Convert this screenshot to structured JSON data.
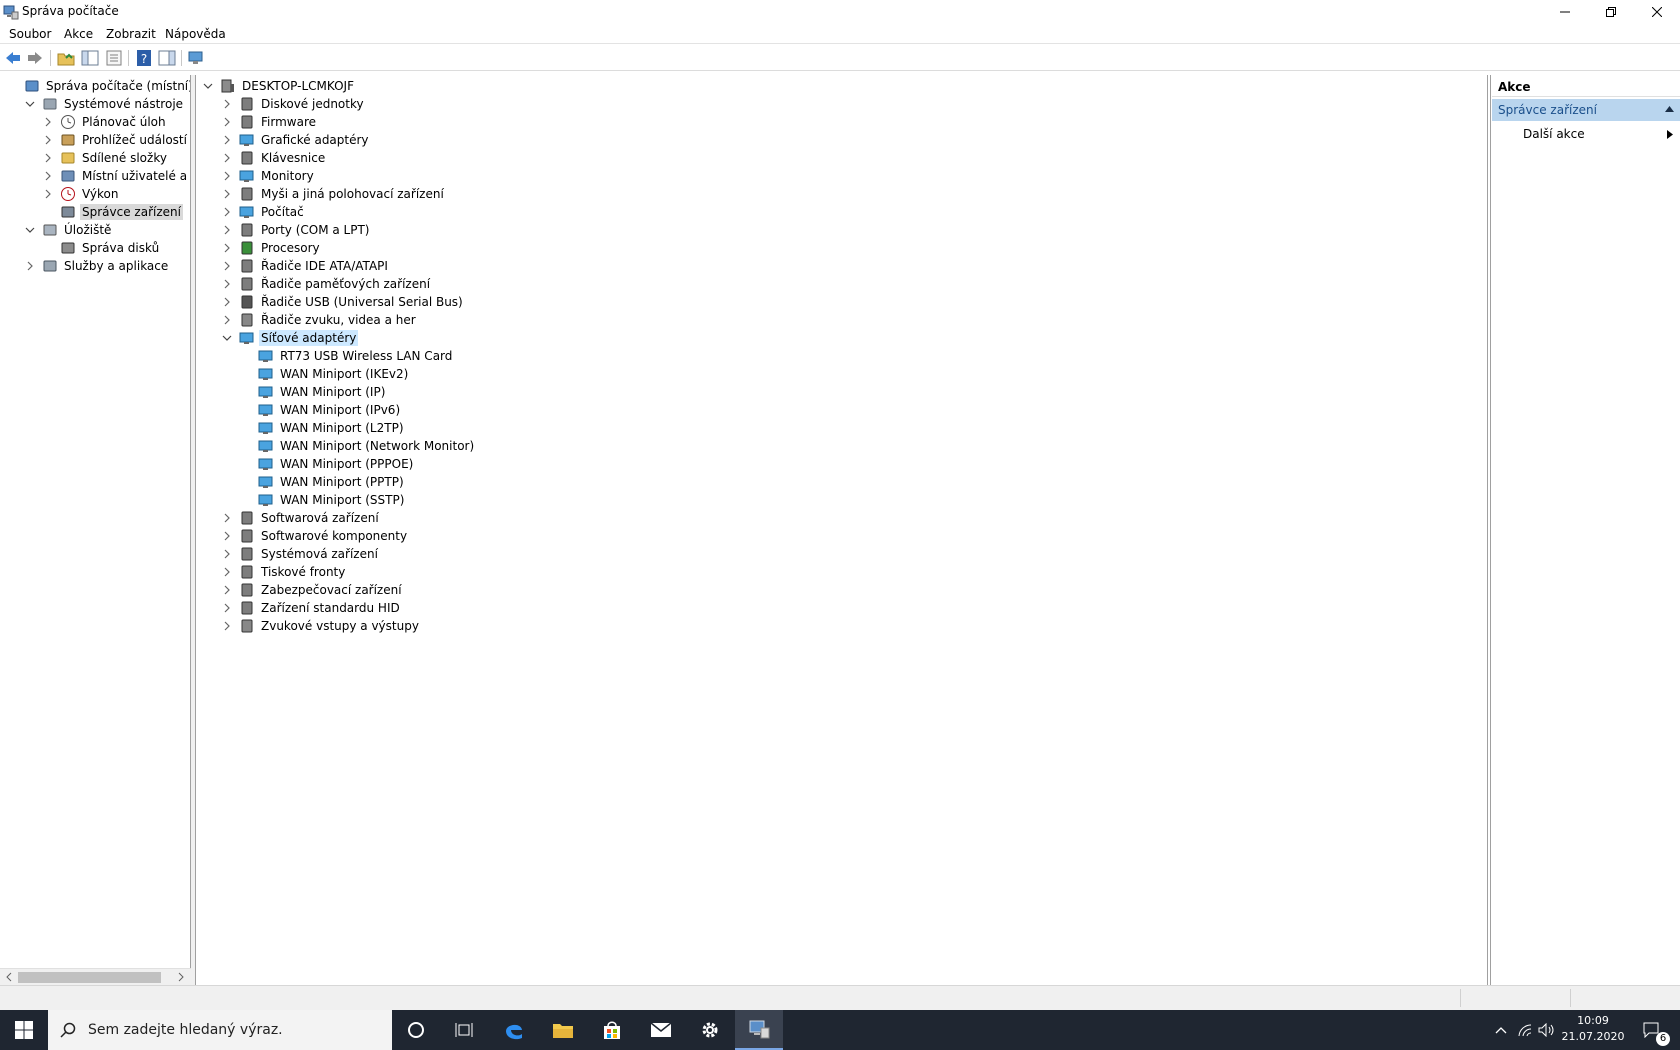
{
  "window": {
    "title": "Správa počítače"
  },
  "menu": [
    "Soubor",
    "Akce",
    "Zobrazit",
    "Nápověda"
  ],
  "left_tree": [
    {
      "label": "Správa počítače (místní)",
      "icon": "computer-management-icon",
      "level": 0,
      "expander": "none"
    },
    {
      "label": "Systémové nástroje",
      "icon": "tools-icon",
      "level": 1,
      "expander": "expanded"
    },
    {
      "label": "Plánovač úloh",
      "icon": "clock-icon",
      "level": 2,
      "expander": "collapsed"
    },
    {
      "label": "Prohlížeč událostí",
      "icon": "event-viewer-icon",
      "level": 2,
      "expander": "collapsed"
    },
    {
      "label": "Sdílené složky",
      "icon": "shared-folder-icon",
      "level": 2,
      "expander": "collapsed"
    },
    {
      "label": "Místní uživatelé a skupiny",
      "icon": "users-icon",
      "level": 2,
      "expander": "collapsed"
    },
    {
      "label": "Výkon",
      "icon": "performance-icon",
      "level": 2,
      "expander": "collapsed"
    },
    {
      "label": "Správce zařízení",
      "icon": "device-manager-icon",
      "level": 2,
      "expander": "none",
      "selected": true
    },
    {
      "label": "Úložiště",
      "icon": "storage-icon",
      "level": 1,
      "expander": "expanded"
    },
    {
      "label": "Správa disků",
      "icon": "disk-icon",
      "level": 2,
      "expander": "none"
    },
    {
      "label": "Služby a aplikace",
      "icon": "services-icon",
      "level": 1,
      "expander": "collapsed"
    }
  ],
  "device_tree": {
    "root": "DESKTOP-LCMKOJF",
    "categories": [
      {
        "label": "Diskové jednotky",
        "icon": "disk-drive-icon"
      },
      {
        "label": "Firmware",
        "icon": "firmware-icon"
      },
      {
        "label": "Grafické adaptéry",
        "icon": "display-adapter-icon"
      },
      {
        "label": "Klávesnice",
        "icon": "keyboard-icon"
      },
      {
        "label": "Monitory",
        "icon": "monitor-icon"
      },
      {
        "label": "Myši a jiná polohovací zařízení",
        "icon": "mouse-icon"
      },
      {
        "label": "Počítač",
        "icon": "computer-icon"
      },
      {
        "label": "Porty (COM a LPT)",
        "icon": "port-icon"
      },
      {
        "label": "Procesory",
        "icon": "processor-icon"
      },
      {
        "label": "Řadiče IDE ATA/ATAPI",
        "icon": "ide-controller-icon"
      },
      {
        "label": "Řadiče paměťových zařízení",
        "icon": "storage-controller-icon"
      },
      {
        "label": "Řadiče USB (Universal Serial Bus)",
        "icon": "usb-icon"
      },
      {
        "label": "Řadiče zvuku, videa a her",
        "icon": "sound-icon"
      },
      {
        "label": "Síťové adaptéry",
        "icon": "network-adapter-icon",
        "expanded": true,
        "children": [
          "RT73 USB Wireless LAN Card",
          "WAN Miniport (IKEv2)",
          "WAN Miniport (IP)",
          "WAN Miniport (IPv6)",
          "WAN Miniport (L2TP)",
          "WAN Miniport (Network Monitor)",
          "WAN Miniport (PPPOE)",
          "WAN Miniport (PPTP)",
          "WAN Miniport (SSTP)"
        ]
      },
      {
        "label": "Softwarová zařízení",
        "icon": "software-device-icon"
      },
      {
        "label": "Softwarové komponenty",
        "icon": "software-component-icon"
      },
      {
        "label": "Systémová zařízení",
        "icon": "system-device-icon"
      },
      {
        "label": "Tiskové fronty",
        "icon": "printer-icon"
      },
      {
        "label": "Zabezpečovací zařízení",
        "icon": "security-device-icon"
      },
      {
        "label": "Zařízení standardu HID",
        "icon": "hid-icon"
      },
      {
        "label": "Zvukové vstupy a výstupy",
        "icon": "speaker-icon"
      }
    ]
  },
  "actions": {
    "title": "Akce",
    "section": "Správce zařízení",
    "item": "Další akce"
  },
  "taskbar": {
    "search_placeholder": "Sem zadejte hledaný výraz.",
    "time": "10:09",
    "date": "21.07.2020",
    "notifications": "6"
  },
  "colors": {
    "taskbar": "#1f2631",
    "selection": "#cce8ff",
    "action_header": "#b9d5ee"
  }
}
